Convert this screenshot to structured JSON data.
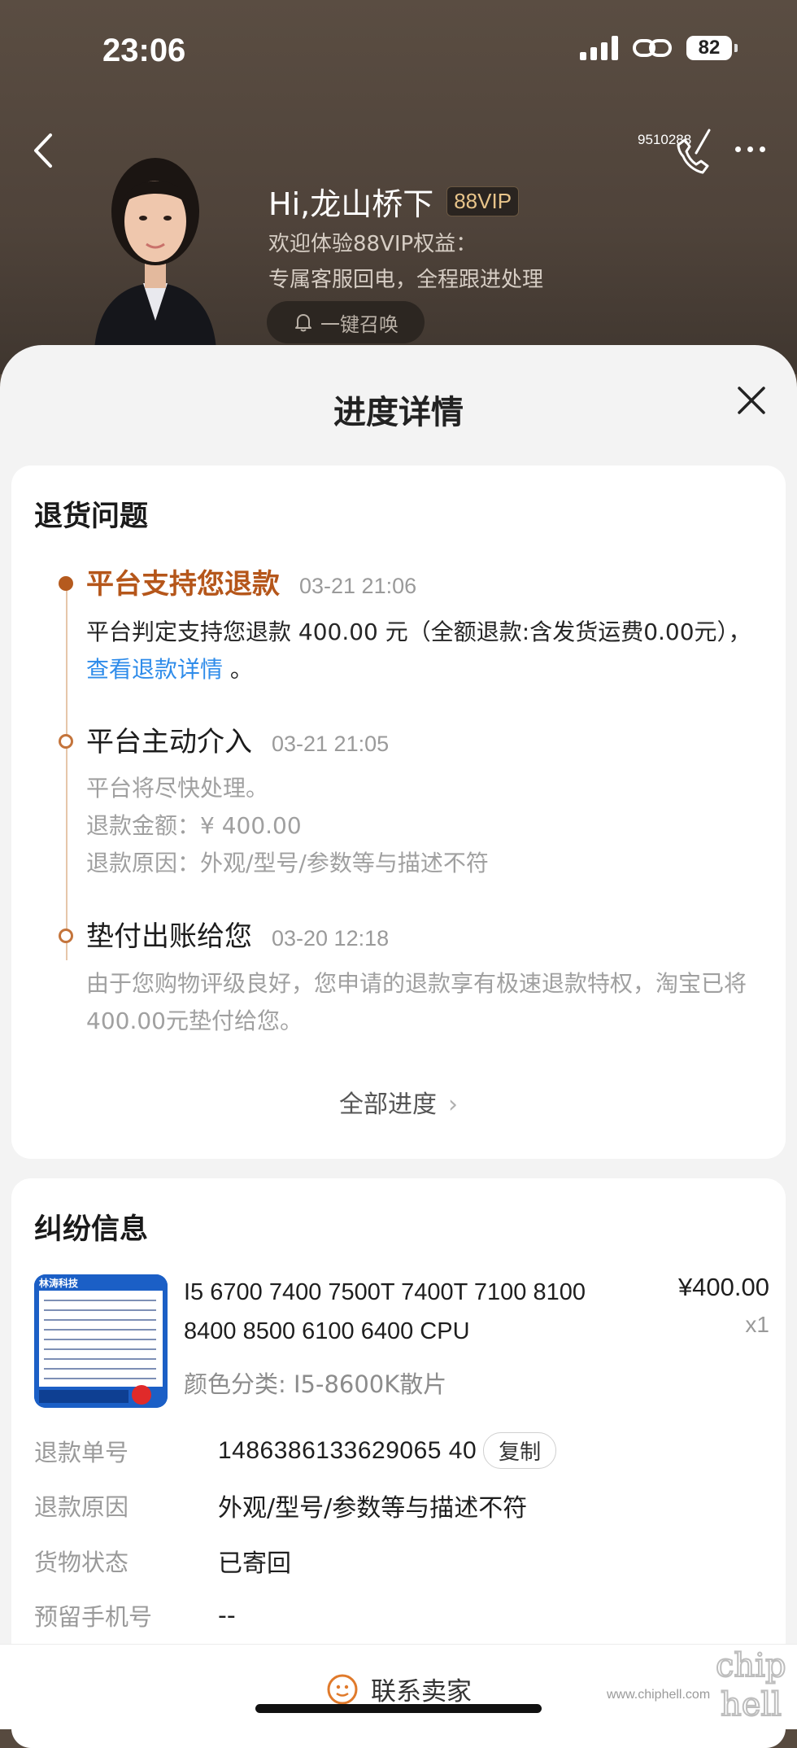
{
  "status_bar": {
    "time": "23:06",
    "battery": "82"
  },
  "header": {
    "phone_number": "9510288",
    "greeting": "Hi,龙山桥下",
    "vip_badge": "88VIP",
    "subtitle_line1": "欢迎体验88VIP权益：",
    "subtitle_line2": "专属客服回电，全程跟进处理",
    "summon_button": "一键召唤"
  },
  "sheet": {
    "title": "进度详情",
    "progress_card": {
      "heading": "退货问题",
      "events": [
        {
          "title": "平台支持您退款",
          "time": "03-21 21:06",
          "body_prefix": "平台判定支持您退款 400.00 元（全额退款:含发货运费0.00元），",
          "link_text": "查看退款详情",
          "body_suffix": "。"
        },
        {
          "title": "平台主动介入",
          "time": "03-21 21:05",
          "line1": "平台将尽快处理。",
          "line2": "退款金额：¥ 400.00",
          "line3": "退款原因：外观/型号/参数等与描述不符"
        },
        {
          "title": "垫付出账给您",
          "time": "03-20 12:18",
          "body": "由于您购物评级良好，您申请的退款享有极速退款特权，淘宝已将400.00元垫付给您。"
        }
      ],
      "all_progress": "全部进度"
    },
    "dispute_card": {
      "heading": "纠纷信息",
      "product": {
        "title": "I5 6700 7400 7500T 7400T 7100 8100 8400 8500 6100 6400 CPU",
        "sku": "颜色分类: I5-8600K散片",
        "price": "¥400.00",
        "qty": "x1",
        "image_text": "林涛科技"
      },
      "rows": [
        {
          "label": "退款单号",
          "value": "1486386133629065 40"
        },
        {
          "label": "退款原因",
          "value": "外观/型号/参数等与描述不符"
        },
        {
          "label": "货物状态",
          "value": "已寄回"
        },
        {
          "label": "预留手机号",
          "value": "--"
        }
      ],
      "copy_label": "复制"
    },
    "contact_seller": "联系卖家"
  },
  "watermark": "www.chiphell.com"
}
